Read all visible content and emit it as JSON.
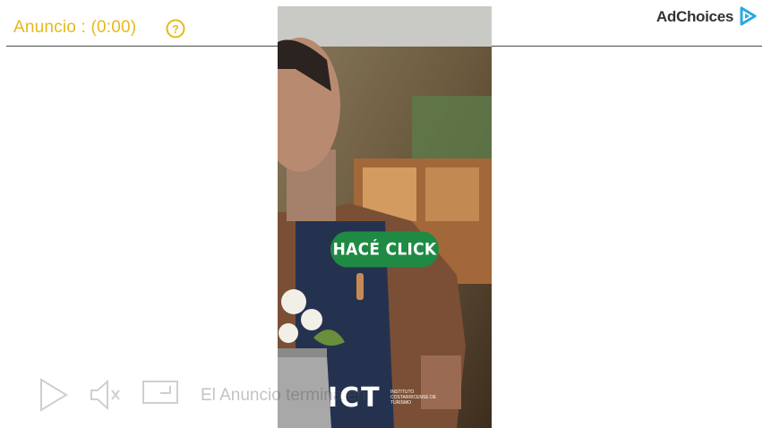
{
  "ad_header": {
    "label": "Anuncio : (0:00)",
    "help_icon": "question-circle-icon",
    "accent_color": "#e8b81c"
  },
  "adchoices": {
    "label": "AdChoices",
    "icon": "adchoices-triangle-icon",
    "icon_color": "#27a9e1"
  },
  "video": {
    "cta_label": "HACÉ CLICK",
    "cta_color": "#1f8a43",
    "logo_text": "ICT",
    "logo_subtext": "INSTITUTO COSTARRICENSE DE TURISMO"
  },
  "controls": {
    "play_icon": "play-icon",
    "mute_icon": "mute-icon",
    "fullscreen_icon": "fullscreen-icon",
    "status_text": "El Anuncio termina en"
  }
}
